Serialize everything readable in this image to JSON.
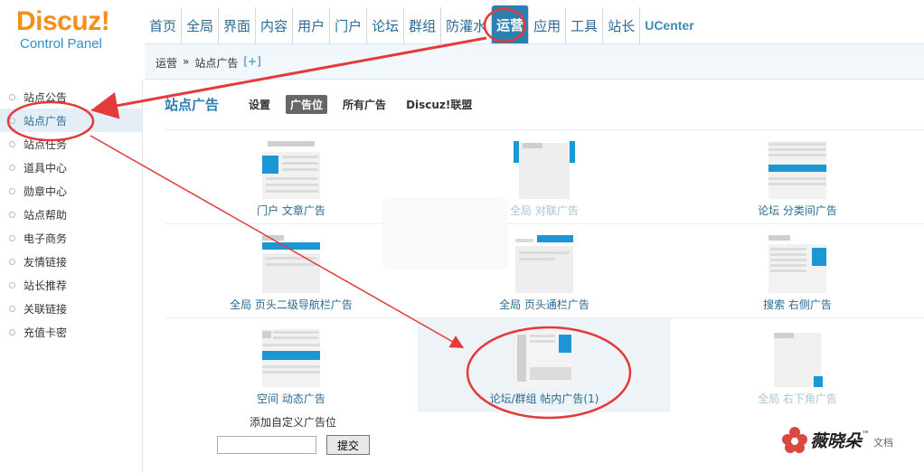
{
  "logo": {
    "title": "Discuz!",
    "subtitle": "Control Panel"
  },
  "nav": [
    {
      "label": "首页",
      "active": false
    },
    {
      "label": "全局",
      "active": false
    },
    {
      "label": "界面",
      "active": false
    },
    {
      "label": "内容",
      "active": false
    },
    {
      "label": "用户",
      "active": false
    },
    {
      "label": "门户",
      "active": false
    },
    {
      "label": "论坛",
      "active": false
    },
    {
      "label": "群组",
      "active": false
    },
    {
      "label": "防灌水",
      "active": false
    },
    {
      "label": "运营",
      "active": true
    },
    {
      "label": "应用",
      "active": false
    },
    {
      "label": "工具",
      "active": false
    },
    {
      "label": "站长",
      "active": false
    },
    {
      "label": "UCenter",
      "active": false
    }
  ],
  "breadcrumb": {
    "section": "运营",
    "separator": "»",
    "page": "站点广告",
    "add": "[+]"
  },
  "sidebar": {
    "items": [
      {
        "label": "站点公告",
        "active": false
      },
      {
        "label": "站点广告",
        "active": true
      },
      {
        "label": "站点任务",
        "active": false
      },
      {
        "label": "道具中心",
        "active": false
      },
      {
        "label": "勋章中心",
        "active": false
      },
      {
        "label": "站点帮助",
        "active": false
      },
      {
        "label": "电子商务",
        "active": false
      },
      {
        "label": "友情链接",
        "active": false
      },
      {
        "label": "站长推荐",
        "active": false
      },
      {
        "label": "关联链接",
        "active": false
      },
      {
        "label": "充值卡密",
        "active": false
      }
    ]
  },
  "main": {
    "title": "站点广告",
    "tabs": [
      {
        "label": "设置",
        "active": false
      },
      {
        "label": "广告位",
        "active": true
      },
      {
        "label": "所有广告",
        "active": false
      },
      {
        "label": "Discuz!联盟",
        "active": false
      }
    ],
    "ad_slots": [
      {
        "caption": "门户 文章广告",
        "icon": "article-ad-icon"
      },
      {
        "caption": "全局 对联广告",
        "icon": "couplet-ad-icon"
      },
      {
        "caption": "论坛 分类间广告",
        "icon": "category-ad-icon"
      },
      {
        "caption": "全局 页头二级导航栏广告",
        "icon": "subnav-ad-icon"
      },
      {
        "caption": "全局 页头通栏广告",
        "icon": "header-banner-ad-icon"
      },
      {
        "caption": "搜索 右侧广告",
        "icon": "search-right-ad-icon"
      },
      {
        "caption": "空间 动态广告",
        "icon": "feed-ad-icon"
      },
      {
        "caption": "论坛/群组 帖内广告(1)",
        "icon": "in-thread-ad-icon"
      },
      {
        "caption": "全局 右下角广告",
        "icon": "corner-ad-icon"
      }
    ],
    "custom": {
      "label": "添加自定义广告位",
      "input_value": "",
      "submit_label": "提交"
    }
  },
  "watermark": {
    "text": "薇晓朵",
    "tm": "™",
    "sub": "文档"
  },
  "colors": {
    "accent": "#2c7fb1",
    "ad_block": "#1a97d4",
    "annotation": "#e43a3a",
    "logo_orange": "#f38f1a"
  }
}
